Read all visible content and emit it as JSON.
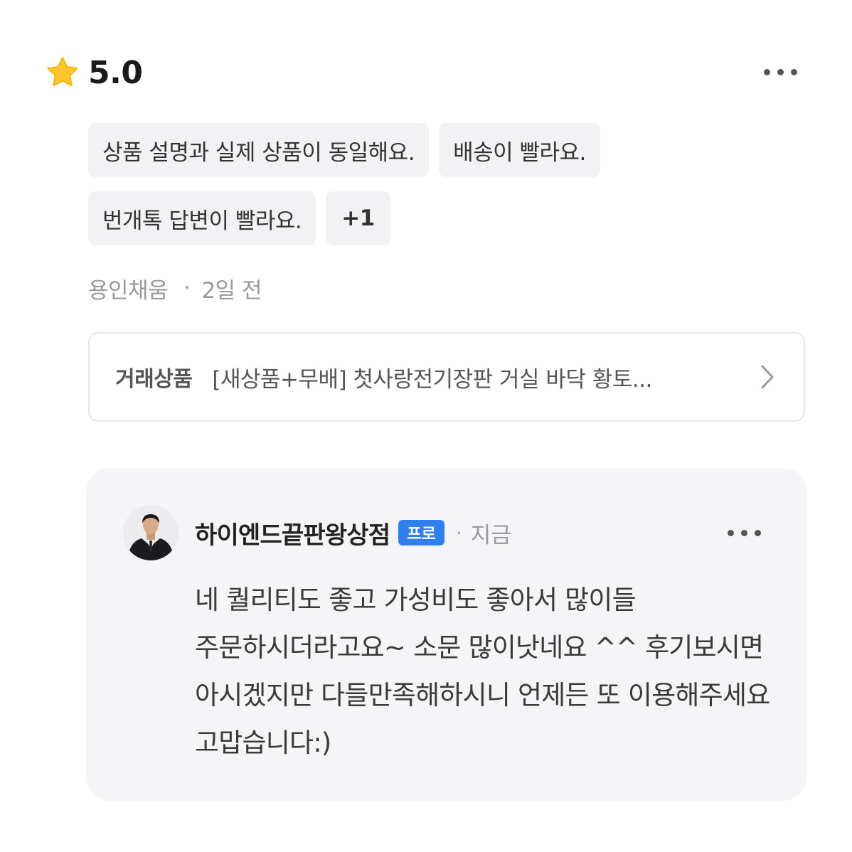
{
  "review": {
    "rating": "5.0",
    "tags": [
      "상품 설명과 실제 상품이 동일해요.",
      "배송이 빨라요.",
      "번개톡 답변이 빨라요."
    ],
    "more_tags_label": "+1",
    "reviewer": "용인채움",
    "separator": "·",
    "time": "2일 전",
    "product_label": "거래상품",
    "product_title": "[새상품+무배] 첫사랑전기장판 거실 바닥 황토..."
  },
  "reply": {
    "seller_name": "하이엔드끝판왕상점",
    "badge": "프로",
    "separator": "·",
    "time": "지금",
    "text": "네 퀄리티도 좋고 가성비도 좋아서 많이들 주문하시더라고요~ 소문 많이낫네요 ^^ 후기보시면 아시겠지만 다들만족해하시니 언제든 또 이용해주세요 고맙습니다:)"
  },
  "colors": {
    "star": "#FFC52B",
    "badge": "#2F7FF0",
    "card_background": "#F5F5F7",
    "tag_background": "#F2F2F4"
  },
  "icons": {
    "rating": "star-icon",
    "product_link": "chevron-right-icon",
    "menu": "more-options-icon"
  }
}
